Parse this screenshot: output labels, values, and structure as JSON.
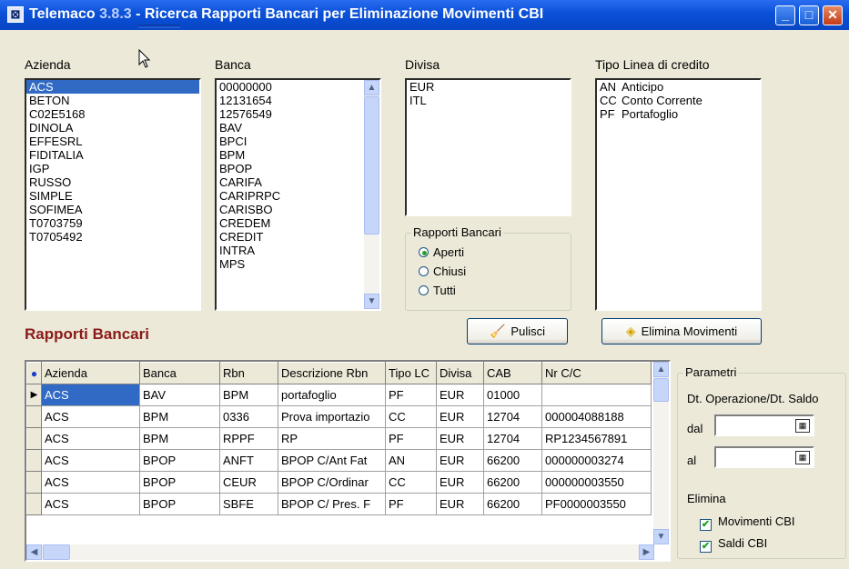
{
  "window": {
    "app_name": "Telemaco",
    "version": "3.8.3",
    "title_rest": " - Ricerca Rapporti Bancari per Eliminazione Movimenti CBI",
    "icon": "app-icon"
  },
  "filters": {
    "azienda": {
      "label": "Azienda",
      "items": [
        "ACS",
        "BETON",
        "C02E5168",
        "DINOLA",
        "EFFESRL",
        "FIDITALIA",
        "IGP",
        "RUSSO",
        "SIMPLE",
        "SOFIMEA",
        "T0703759",
        "T0705492"
      ],
      "selected": "ACS"
    },
    "banca": {
      "label": "Banca",
      "items": [
        "00000000",
        "12131654",
        "12576549",
        "BAV",
        "BPCI",
        "BPM",
        "BPOP",
        "CARIFA",
        "CARIPRPC",
        "CARISBO",
        "CREDEM",
        "CREDIT",
        "INTRA",
        "MPS"
      ]
    },
    "divisa": {
      "label": "Divisa",
      "items": [
        "EUR",
        "ITL"
      ]
    },
    "tipo_linea": {
      "label": "Tipo Linea di credito",
      "items": [
        {
          "code": "AN",
          "desc": "Anticipo"
        },
        {
          "code": "CC",
          "desc": "Conto Corrente"
        },
        {
          "code": "PF",
          "desc": "Portafoglio"
        }
      ]
    }
  },
  "rapporti_group": {
    "title": "Rapporti Bancari",
    "options": [
      "Aperti",
      "Chiusi",
      "Tutti"
    ],
    "selected": "Aperti"
  },
  "section_title": "Rapporti Bancari",
  "buttons": {
    "pulisci": "Pulisci",
    "elimina": "Elimina Movimenti"
  },
  "grid": {
    "columns": [
      "Azienda",
      "Banca",
      "Rbn",
      "Descrizione Rbn",
      "Tipo LC",
      "Divisa",
      "CAB",
      "Nr C/C"
    ],
    "rows": [
      [
        "ACS",
        "BAV",
        "BPM",
        "portafoglio",
        "PF",
        "EUR",
        "01000",
        ""
      ],
      [
        "ACS",
        "BPM",
        "0336",
        "Prova importazio",
        "CC",
        "EUR",
        "12704",
        "000004088188"
      ],
      [
        "ACS",
        "BPM",
        "RPPF",
        "RP",
        "PF",
        "EUR",
        "12704",
        "RP1234567891"
      ],
      [
        "ACS",
        "BPOP",
        "ANFT",
        "BPOP C/Ant Fat",
        "AN",
        "EUR",
        "66200",
        "000000003274"
      ],
      [
        "ACS",
        "BPOP",
        "CEUR",
        "BPOP C/Ordinar",
        "CC",
        "EUR",
        "66200",
        "000000003550"
      ],
      [
        "ACS",
        "BPOP",
        "SBFE",
        "BPOP C/ Pres. F",
        "PF",
        "EUR",
        "66200",
        "PF0000003550"
      ]
    ]
  },
  "parametri": {
    "title": "Parametri",
    "date_label": "Dt. Operazione/Dt. Saldo",
    "dal_label": "dal",
    "al_label": "al",
    "dal_value": "",
    "al_value": "",
    "elimina_label": "Elimina",
    "checks": [
      {
        "label": "Movimenti CBI",
        "checked": true
      },
      {
        "label": "Saldi CBI",
        "checked": true
      }
    ]
  }
}
